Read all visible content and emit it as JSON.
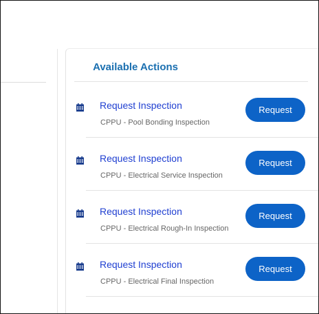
{
  "panel": {
    "title": "Available Actions"
  },
  "actions": [
    {
      "link": "Request Inspection",
      "subtitle": "CPPU - Pool Bonding Inspection",
      "button": "Request"
    },
    {
      "link": "Request Inspection",
      "subtitle": "CPPU - Electrical Service Inspection",
      "button": "Request"
    },
    {
      "link": "Request Inspection",
      "subtitle": "CPPU - Electrical Rough-In Inspection",
      "button": "Request"
    },
    {
      "link": "Request Inspection",
      "subtitle": "CPPU - Electrical Final Inspection",
      "button": "Request"
    }
  ],
  "colors": {
    "title": "#1a6fb0",
    "link": "#1f3fd1",
    "button": "#0d63c7",
    "icon": "#1c3f8f"
  },
  "icons": {
    "row_icon": "calendar-icon"
  }
}
